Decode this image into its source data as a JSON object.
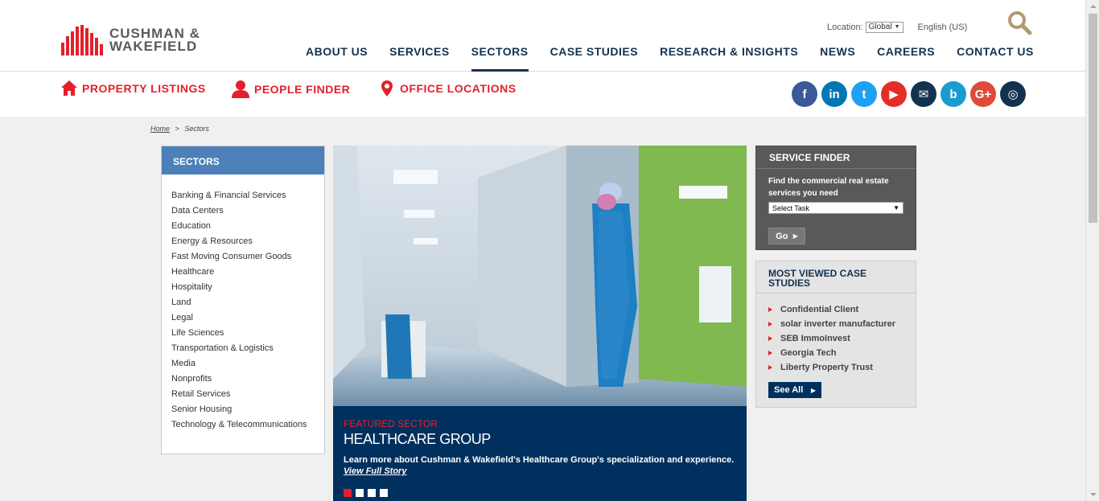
{
  "header": {
    "logo": {
      "line1": "CUSHMAN &",
      "line2": "WAKEFIELD"
    },
    "location_label": "Location:",
    "location_value": "Global",
    "language": "English (US)",
    "nav": [
      {
        "label": "ABOUT US",
        "active": false
      },
      {
        "label": "SERVICES",
        "active": false
      },
      {
        "label": "SECTORS",
        "active": true
      },
      {
        "label": "CASE STUDIES",
        "active": false
      },
      {
        "label": "RESEARCH & INSIGHTS",
        "active": false
      },
      {
        "label": "NEWS",
        "active": false
      },
      {
        "label": "CAREERS",
        "active": false
      },
      {
        "label": "CONTACT US",
        "active": false
      }
    ]
  },
  "quicklinks": {
    "property": "PROPERTY LISTINGS",
    "people": "PEOPLE FINDER",
    "offices": "OFFICE LOCATIONS"
  },
  "social": [
    {
      "name": "facebook",
      "glyph": "f",
      "color": "#3b5998"
    },
    {
      "name": "linkedin",
      "glyph": "in",
      "color": "#0077b5"
    },
    {
      "name": "twitter",
      "glyph": "t",
      "color": "#1da1f2"
    },
    {
      "name": "youtube",
      "glyph": "▶",
      "color": "#e52d27"
    },
    {
      "name": "email",
      "glyph": "✉",
      "color": "#13324f"
    },
    {
      "name": "blog",
      "glyph": "b",
      "color": "#1c9bd1"
    },
    {
      "name": "google-plus",
      "glyph": "G+",
      "color": "#dd4b39"
    },
    {
      "name": "instagram",
      "glyph": "◎",
      "color": "#13324f"
    }
  ],
  "breadcrumb": {
    "home": "Home",
    "sep": ">",
    "current": "Sectors"
  },
  "sectors": {
    "title": "SECTORS",
    "items": [
      "Banking & Financial Services",
      "Data Centers",
      "Education",
      "Energy & Resources",
      "Fast Moving Consumer Goods",
      "Healthcare",
      "Hospitality",
      "Land",
      "Legal",
      "Life Sciences",
      "Transportation & Logistics",
      "Media",
      "Nonprofits",
      "Retail Services",
      "Senior Housing",
      "Technology & Telecommunications"
    ]
  },
  "featured": {
    "kicker": "FEATURED SECTOR",
    "title": "HEALTHCARE GROUP",
    "description": "Learn more about Cushman & Wakefield's Healthcare Group's specialization and experience.",
    "link": "View Full Story",
    "slides": 4,
    "active_slide": 0
  },
  "finder": {
    "title": "SERVICE FINDER",
    "subtitle": "Find the commercial real estate services you need",
    "select_value": "Select Task",
    "go": "Go"
  },
  "most_viewed": {
    "title": "MOST VIEWED CASE STUDIES",
    "items": [
      "Confidential Client",
      "solar inverter manufacturer",
      "SEB ImmoInvest",
      "Georgia Tech",
      "Liberty Property Trust"
    ],
    "see_all": "See All"
  }
}
